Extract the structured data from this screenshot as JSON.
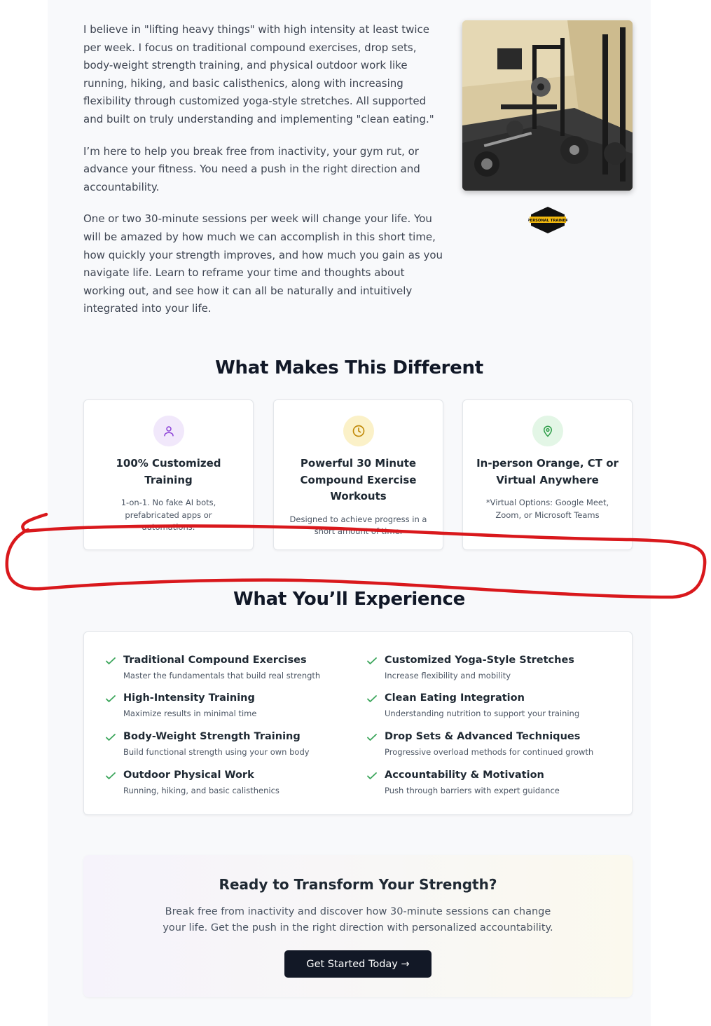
{
  "intro": {
    "paragraphs": [
      "I believe in \"lifting heavy things\" with high intensity at least twice per week. I focus on traditional compound exercises, drop sets, body-weight strength training, and physical outdoor work like running, hiking, and basic calisthenics, along with increasing flexibility through customized yoga-style stretches. All supported and built on truly understanding and implementing \"clean eating.\"",
      "I’m here to help you break free from inactivity, your gym rut, or advance your fitness. You need a push in the right direction and accountability.",
      "One or two 30-minute sessions per week will change your life. You will be amazed by how much we can accomplish in this short time, how quickly your strength improves, and how much you gain as you navigate life. Learn to reframe your time and thoughts about working out, and see how it can all be naturally and intuitively integrated into your life."
    ],
    "badge_text": "PERSONAL TRAINER"
  },
  "different": {
    "title": "What Makes This Different",
    "cards": [
      {
        "icon": "user-icon",
        "title": "100% Customized Training",
        "desc": "1-on-1. No fake AI bots, prefabricated apps or automations.",
        "icon_bg": "#f1e8fb",
        "icon_color": "#8b3fd6"
      },
      {
        "icon": "clock-icon",
        "title": "Powerful 30 Minute Compound Exercise Workouts",
        "desc": "Designed to achieve progress in a short amount of time.",
        "icon_bg": "#fbf1c8",
        "icon_color": "#c18a0a"
      },
      {
        "icon": "location-pin-icon",
        "title": "In-person Orange, CT or Virtual Anywhere",
        "desc": "*Virtual Options: Google Meet, Zoom, or Microsoft Teams",
        "icon_bg": "#e3f6e6",
        "icon_color": "#2f9e4a"
      }
    ]
  },
  "experience": {
    "title": "What You’ll Experience",
    "items": [
      {
        "title": "Traditional Compound Exercises",
        "desc": "Master the fundamentals that build real strength"
      },
      {
        "title": "Customized Yoga-Style Stretches",
        "desc": "Increase flexibility and mobility"
      },
      {
        "title": "High-Intensity Training",
        "desc": "Maximize results in minimal time"
      },
      {
        "title": "Clean Eating Integration",
        "desc": "Understanding nutrition to support your training"
      },
      {
        "title": "Body-Weight Strength Training",
        "desc": "Build functional strength using your own body"
      },
      {
        "title": "Drop Sets & Advanced Techniques",
        "desc": "Progressive overload methods for continued growth"
      },
      {
        "title": "Outdoor Physical Work",
        "desc": "Running, hiking, and basic calisthenics"
      },
      {
        "title": "Accountability & Motivation",
        "desc": "Push through barriers with expert guidance"
      }
    ],
    "check_color": "#3aa55a"
  },
  "cta": {
    "title": "Ready to Transform Your Strength?",
    "text": "Break free from inactivity and discover how 30-minute sessions can change your life. Get the push in the right direction with personalized accountability.",
    "button": "Get Started Today →"
  },
  "annotation_color": "#d9181c"
}
